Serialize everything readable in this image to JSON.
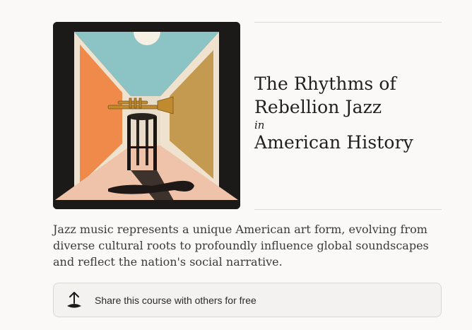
{
  "course": {
    "title_line1": "The Rhythms of",
    "title_line2": "Rebellion Jazz",
    "title_connector": "in",
    "title_line3": "American History",
    "description": "Jazz music represents a unique American art form, evolving from diverse cultural roots to profoundly influence global soundscapes and reflect the nation's social narrative.",
    "cover_image": "trumpet-on-stool-illustration"
  },
  "share": {
    "label": "Share this course with others for free",
    "icon": "share-upload-icon"
  },
  "colors": {
    "background": "#faf9f7",
    "cover_frame": "#1c1a18",
    "sky": "#8fc2c4",
    "left_wall": "#f08a4b",
    "right_wall": "#c49a4e",
    "floor": "#eec4ab"
  }
}
